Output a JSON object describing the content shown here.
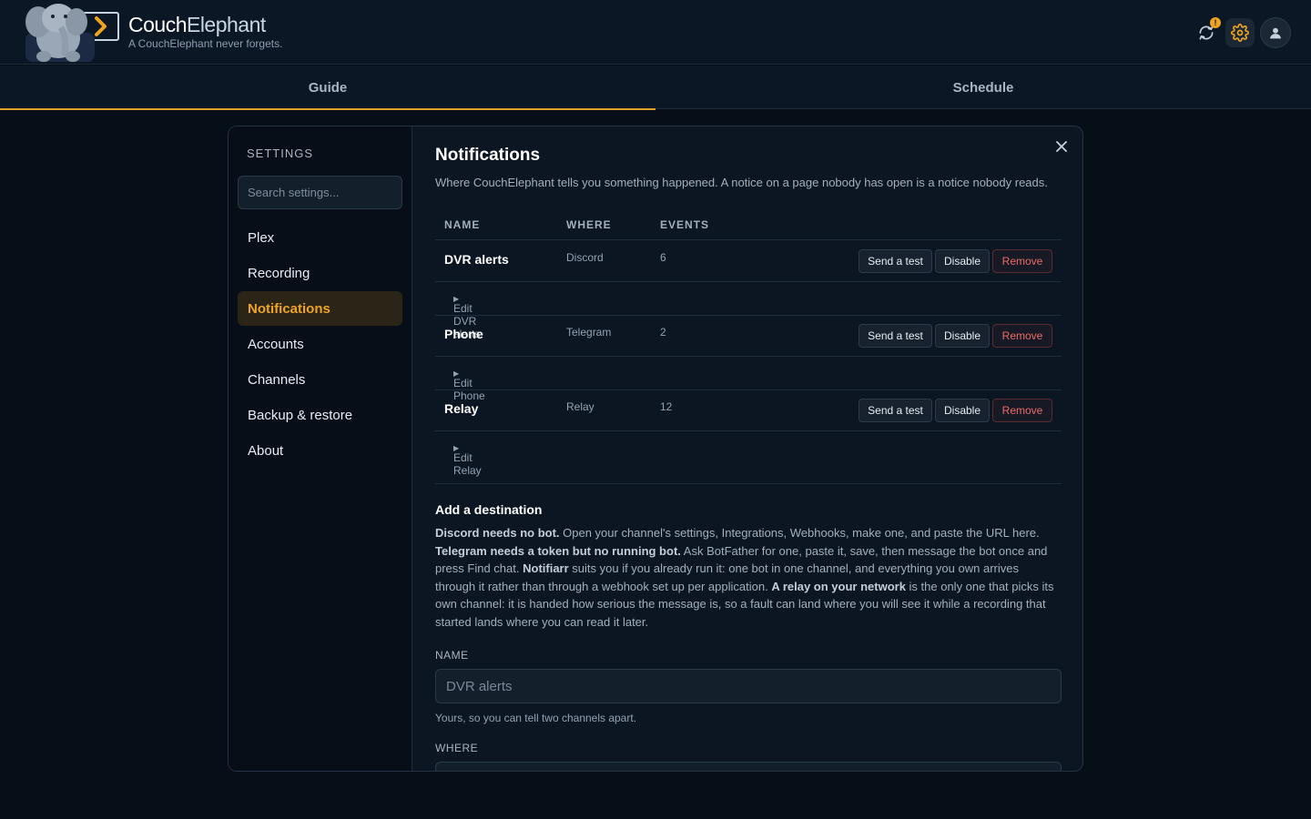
{
  "brand": {
    "name_part1": "Couch",
    "name_part2": "Elephant",
    "tagline": "A CouchElephant never forgets.",
    "badge_count": "!"
  },
  "tabs": [
    {
      "label": "Guide"
    },
    {
      "label": "Schedule"
    }
  ],
  "sidebar": {
    "title": "SETTINGS",
    "search_placeholder": "Search settings...",
    "items": [
      {
        "label": "Plex"
      },
      {
        "label": "Recording"
      },
      {
        "label": "Notifications"
      },
      {
        "label": "Accounts"
      },
      {
        "label": "Channels"
      },
      {
        "label": "Backup & restore"
      },
      {
        "label": "About"
      }
    ]
  },
  "panel": {
    "title": "Notifications",
    "description": "Where CouchElephant tells you something happened. A notice on a page nobody has open is a notice nobody reads.",
    "columns": {
      "name": "NAME",
      "where": "WHERE",
      "events": "EVENTS"
    },
    "actions": {
      "test": "Send a test",
      "disable": "Disable",
      "remove": "Remove"
    },
    "destinations": [
      {
        "name": "DVR alerts",
        "where": "Discord",
        "events": "6",
        "edit_label": "Edit DVR alerts"
      },
      {
        "name": "Phone",
        "where": "Telegram",
        "events": "2",
        "edit_label": "Edit Phone"
      },
      {
        "name": "Relay",
        "where": "Relay",
        "events": "12",
        "edit_label": "Edit Relay"
      }
    ],
    "add": {
      "title": "Add a destination",
      "p1_bold": "Discord needs no bot.",
      "p1": " Open your channel's settings, Integrations, Webhooks, make one, and paste the URL here. ",
      "p2_bold": "Telegram needs a token but no running bot.",
      "p2": " Ask BotFather for one, paste it, save, then message the bot once and press Find chat. ",
      "p3_bold": "Notifiarr",
      "p3": " suits you if you already run it: one bot in one channel, and everything you own arrives through it rather than through a webhook set up per application. ",
      "p4_bold": "A relay on your network",
      "p4": " is the only one that picks its own channel: it is handed how serious the message is, so a fault can land where you will see it while a recording that started lands where you can read it later.",
      "name_label": "NAME",
      "name_placeholder": "DVR alerts",
      "name_hint": "Yours, so you can tell two channels apart.",
      "where_label": "WHERE"
    }
  },
  "colors": {
    "accent": "#e0a023",
    "danger": "#ea6a6a",
    "background": "#060e18"
  }
}
